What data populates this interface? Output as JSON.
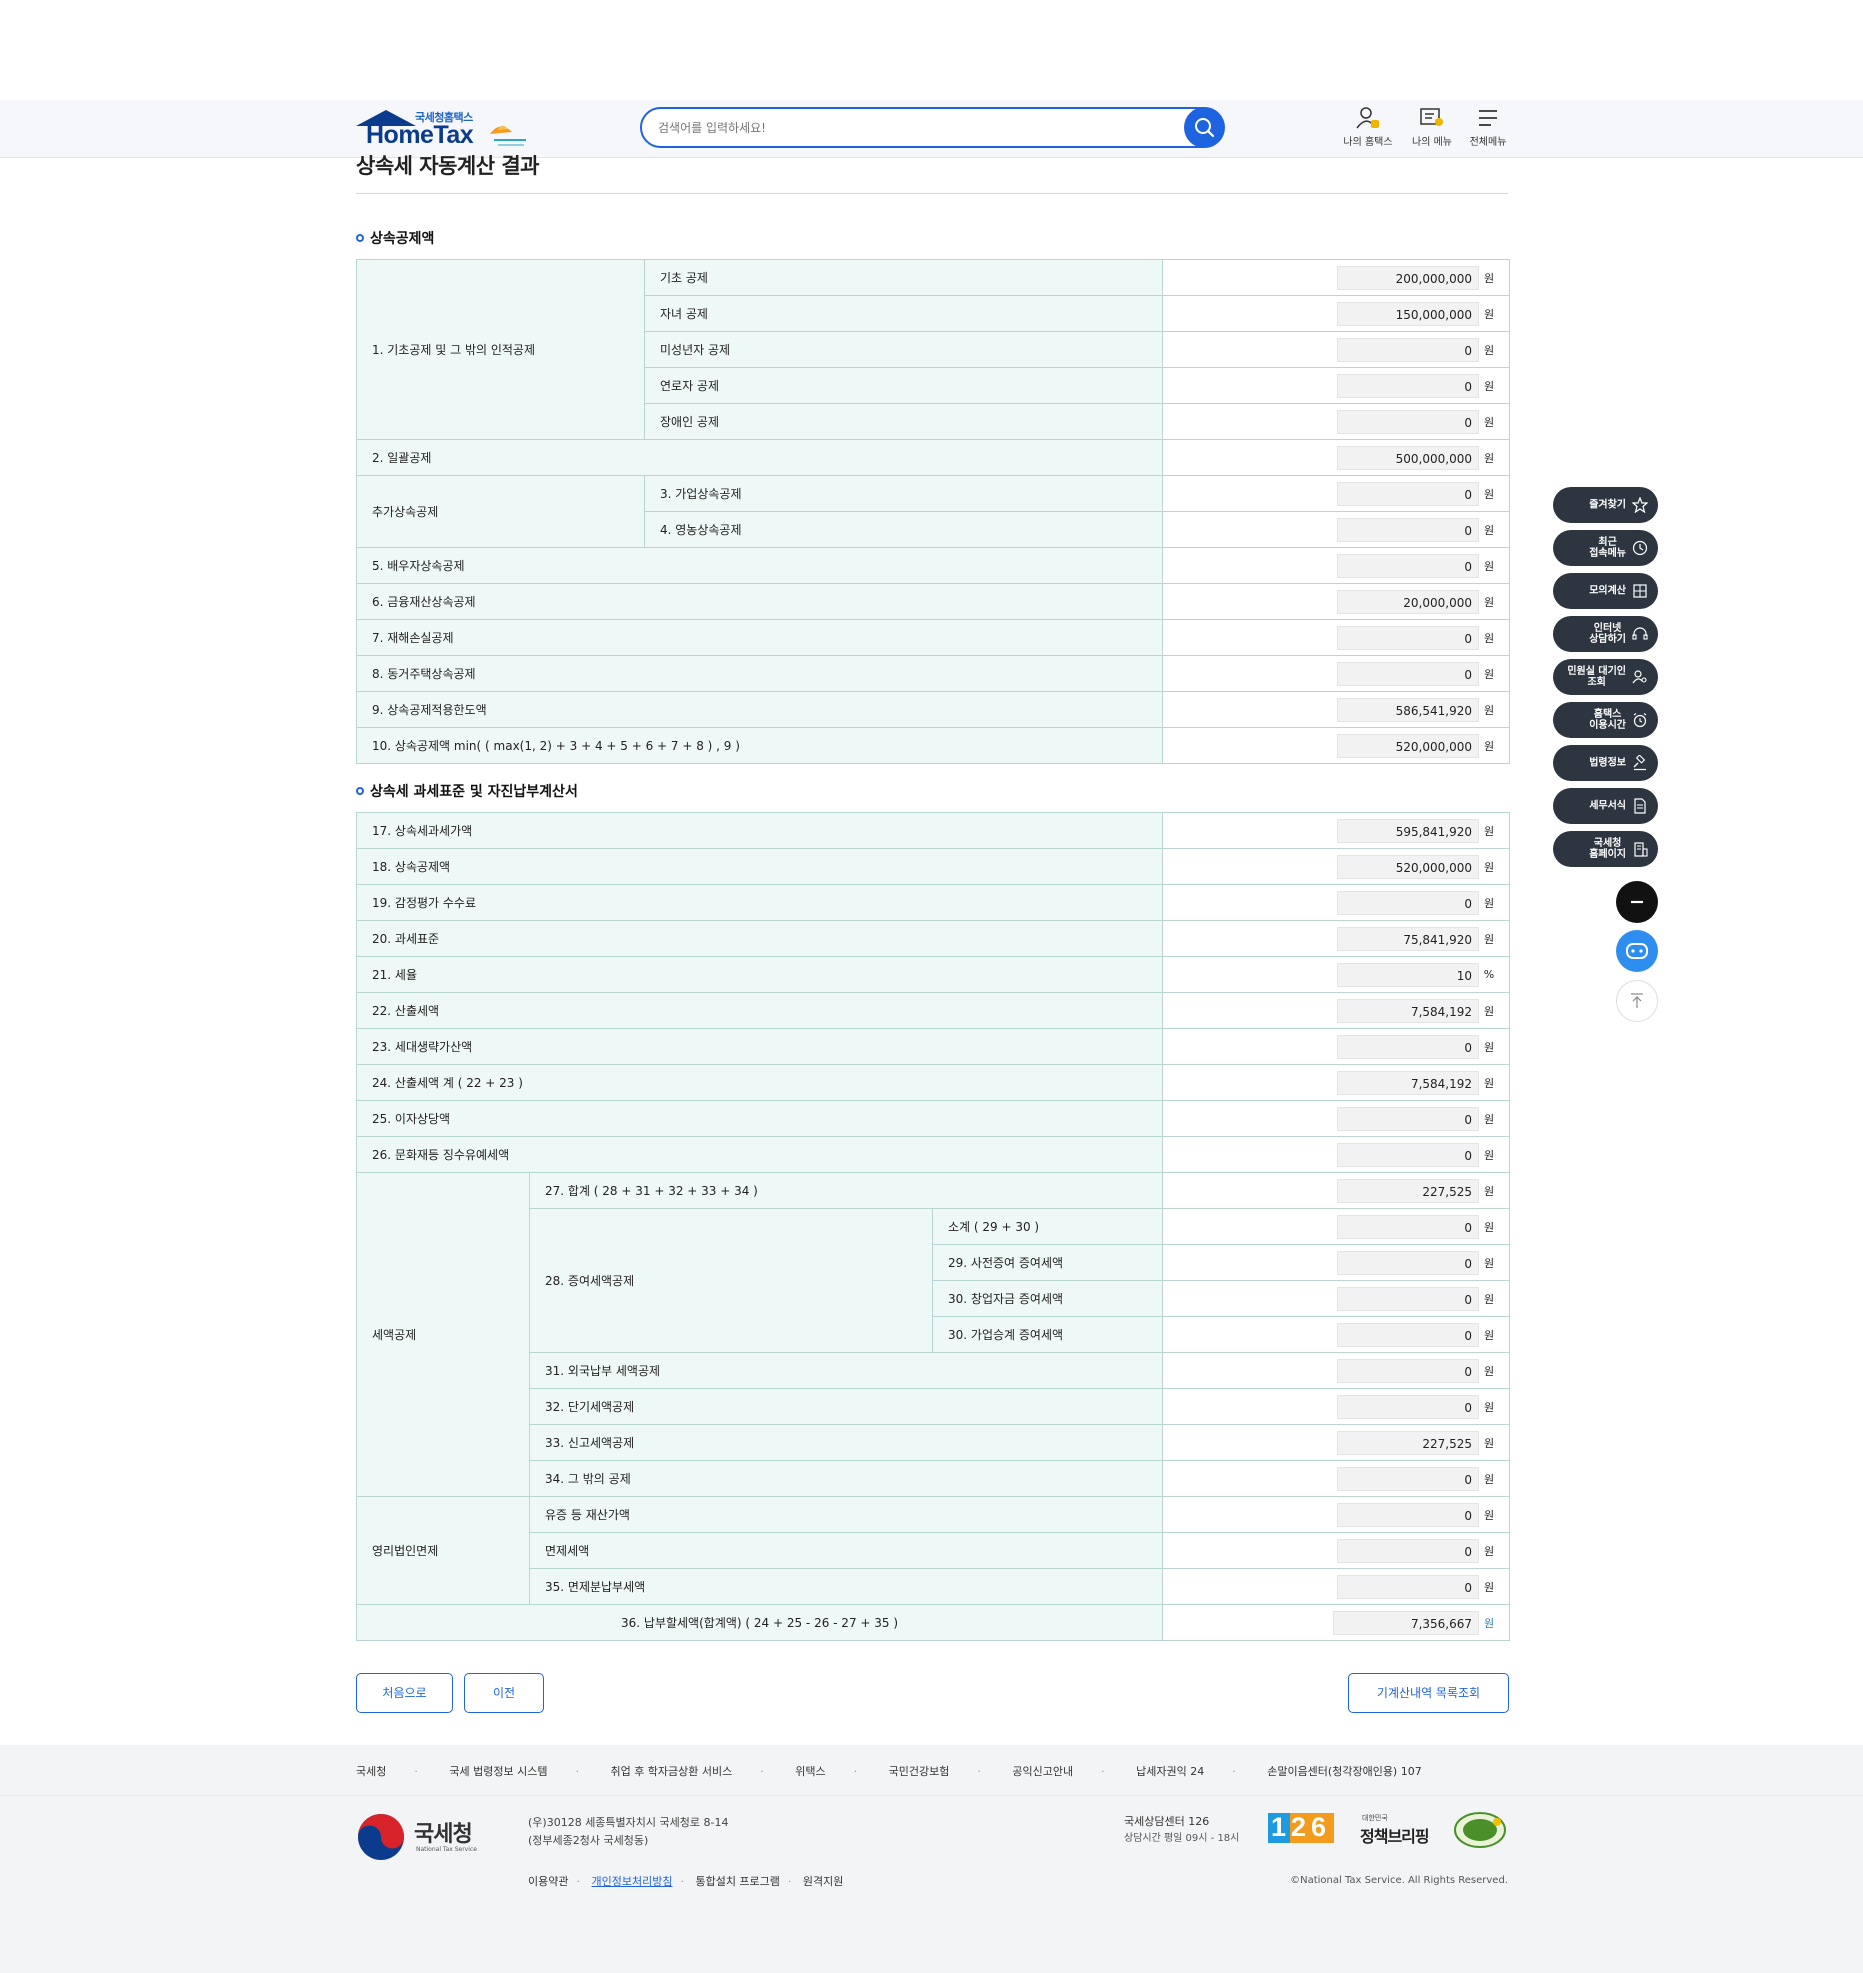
{
  "header": {
    "logo_sub": "국세청홈택스",
    "logo_main": "HomeTax",
    "search_placeholder": "검색어를 입력하세요!",
    "icons": [
      {
        "label": "나의 홈택스",
        "icon": "my-hometax-icon"
      },
      {
        "label": "나의 메뉴",
        "icon": "my-menu-icon"
      },
      {
        "label": "전체메뉴",
        "icon": "all-menu-icon"
      }
    ]
  },
  "page": {
    "title": "상속세 자동계산 결과"
  },
  "section1": {
    "title": "상속공제액",
    "rows": {
      "g1_label": "1. 기초공제 및 그 밖의 인적공제",
      "basic": {
        "label": "기초 공제",
        "value": "200,000,000",
        "unit": "원"
      },
      "child": {
        "label": "자녀 공제",
        "value": "150,000,000",
        "unit": "원"
      },
      "minor": {
        "label": "미성년자 공제",
        "value": "0",
        "unit": "원"
      },
      "elder": {
        "label": "연로자 공제",
        "value": "0",
        "unit": "원"
      },
      "disabled": {
        "label": "장애인 공제",
        "value": "0",
        "unit": "원"
      },
      "lump": {
        "label": "2. 일괄공제",
        "value": "500,000,000",
        "unit": "원"
      },
      "g2_label": "추가상속공제",
      "business": {
        "label": "3. 가업상속공제",
        "value": "0",
        "unit": "원"
      },
      "farm": {
        "label": "4. 영농상속공제",
        "value": "0",
        "unit": "원"
      },
      "spouse": {
        "label": "5. 배우자상속공제",
        "value": "0",
        "unit": "원"
      },
      "financial": {
        "label": "6. 금융재산상속공제",
        "value": "20,000,000",
        "unit": "원"
      },
      "disaster": {
        "label": "7. 재해손실공제",
        "value": "0",
        "unit": "원"
      },
      "cohabit": {
        "label": "8. 동거주택상속공제",
        "value": "0",
        "unit": "원"
      },
      "limit": {
        "label": "9. 상속공제적용한도액",
        "value": "586,541,920",
        "unit": "원"
      },
      "total": {
        "label": "10. 상속공제액 min( ( max(1, 2) + 3 + 4 + 5 + 6 + 7 + 8 ) , 9 )",
        "value": "520,000,000",
        "unit": "원"
      }
    }
  },
  "section2": {
    "title": "상속세 과세표준 및 자진납부계산서",
    "rows": {
      "r17": {
        "label": "17. 상속세과세가액",
        "value": "595,841,920",
        "unit": "원"
      },
      "r18": {
        "label": "18. 상속공제액",
        "value": "520,000,000",
        "unit": "원"
      },
      "r19": {
        "label": "19. 감정평가 수수료",
        "value": "0",
        "unit": "원"
      },
      "r20": {
        "label": "20. 과세표준",
        "value": "75,841,920",
        "unit": "원"
      },
      "r21": {
        "label": "21. 세율",
        "value": "10",
        "unit": "%"
      },
      "r22": {
        "label": "22. 산출세액",
        "value": "7,584,192",
        "unit": "원"
      },
      "r23": {
        "label": "23. 세대생략가산액",
        "value": "0",
        "unit": "원"
      },
      "r24": {
        "label": "24. 산출세액 계 ( 22 + 23 )",
        "value": "7,584,192",
        "unit": "원"
      },
      "r25": {
        "label": "25. 이자상당액",
        "value": "0",
        "unit": "원"
      },
      "r26": {
        "label": "26. 문화재등 징수유예세액",
        "value": "0",
        "unit": "원"
      },
      "credit_label": "세액공제",
      "r27": {
        "label": "27. 합계 ( 28 + 31 + 32 + 33 + 34 )",
        "value": "227,525",
        "unit": "원"
      },
      "r28_label": "28. 증여세액공제",
      "r28_sub": {
        "label": "소계 ( 29 + 30 )",
        "value": "0",
        "unit": "원"
      },
      "r29": {
        "label": "29. 사전증여 증여세액",
        "value": "0",
        "unit": "원"
      },
      "r30a": {
        "label": "30. 창업자금 증여세액",
        "value": "0",
        "unit": "원"
      },
      "r30b": {
        "label": "30. 가업승계 증여세액",
        "value": "0",
        "unit": "원"
      },
      "r31": {
        "label": "31. 외국납부 세액공제",
        "value": "0",
        "unit": "원"
      },
      "r32": {
        "label": "32. 단기세액공제",
        "value": "0",
        "unit": "원"
      },
      "r33": {
        "label": "33. 신고세액공제",
        "value": "227,525",
        "unit": "원"
      },
      "r34": {
        "label": "34. 그 밖의 공제",
        "value": "0",
        "unit": "원"
      },
      "exempt_label": "영리법인면제",
      "ex1": {
        "label": "유증 등 재산가액",
        "value": "0",
        "unit": "원"
      },
      "ex2": {
        "label": "면제세액",
        "value": "0",
        "unit": "원"
      },
      "r35": {
        "label": "35. 면제분납부세액",
        "value": "0",
        "unit": "원"
      },
      "r36": {
        "label": "36. 납부할세액(합계액) ( 24 + 25 - 26 - 27 + 35 )",
        "value": "7,356,667",
        "unit": "원"
      }
    }
  },
  "buttons": {
    "first": "처음으로",
    "prev": "이전",
    "history": "기계산내역 목록조회"
  },
  "quick_menu": [
    {
      "label": "즐겨찾기",
      "icon": "star-icon"
    },
    {
      "label": "최근\n접속메뉴",
      "icon": "clock-icon"
    },
    {
      "label": "모의계산",
      "icon": "calculator-icon"
    },
    {
      "label": "인터넷\n상담하기",
      "icon": "headset-icon"
    },
    {
      "label": "민원실 대기인\n조회",
      "icon": "person-search-icon"
    },
    {
      "label": "홈택스\n이용시간",
      "icon": "alarm-icon"
    },
    {
      "label": "법령정보",
      "icon": "gavel-icon"
    },
    {
      "label": "세무서식",
      "icon": "document-icon"
    },
    {
      "label": "국세청\n홈페이지",
      "icon": "building-icon"
    }
  ],
  "footer": {
    "links": [
      "국세청",
      "국세 법령정보 시스템",
      "취업 후 학자금상환 서비스",
      "위택스",
      "국민건강보험",
      "공익신고안내",
      "납세자권익 24",
      "손말이음센터(청각장애인용) 107"
    ],
    "org_name": "국세청",
    "org_en": "National Tax Service",
    "address1": "(우)30128 세종특별자치시 국세청로 8-14",
    "address2": "(정부세종2청사 국세청동)",
    "center_title": "국세상담센터 126",
    "center_hours": "상담시간 평일 09시 - 18시",
    "logo_126": "126",
    "brief_small": "대한민국",
    "brief_main": "정책브리핑",
    "bottom_links": [
      "이용약관",
      "개인정보처리방침",
      "통합설치 프로그램",
      "원격지원"
    ],
    "copyright": "©National Tax Service. All Rights Reserved."
  }
}
